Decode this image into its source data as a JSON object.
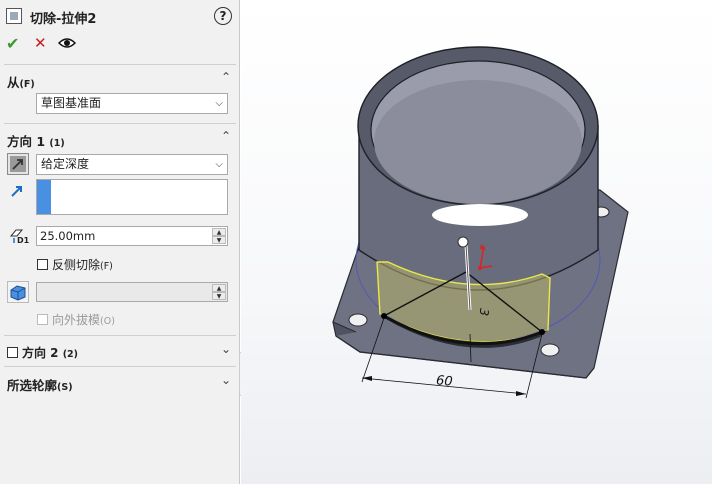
{
  "feature": {
    "title": "切除-拉伸2"
  },
  "section_from": {
    "label": "从",
    "key": "(F)",
    "start_value": "草图基准面"
  },
  "section_dir1": {
    "label": "方向 1",
    "key": "(1)",
    "end_condition": "给定深度",
    "depth_value": "25.00mm",
    "flip_side_label": "反侧切除",
    "flip_side_key": "(F)",
    "draft_outward_label": "向外拔模",
    "draft_outward_key": "(O)"
  },
  "section_dir2": {
    "label": "方向 2",
    "key": "(2)"
  },
  "section_contours": {
    "label": "所选轮廓",
    "key": "(S)"
  },
  "icons": {
    "help": "?",
    "ok": "✔",
    "cancel": "✕",
    "preview": "eye-icon",
    "caret_up": "⌃",
    "caret_down": "⌄",
    "select_arrow": "⌵",
    "spin_up": "▲",
    "spin_down": "▼",
    "depth_tag": "D1"
  },
  "model": {
    "dimension_60": "60",
    "dimension_3": "3"
  },
  "colors": {
    "accent_blue": "#4a90e2",
    "model_gray": "#6b6e7e",
    "highlight_yellow": "#e8e84a"
  }
}
